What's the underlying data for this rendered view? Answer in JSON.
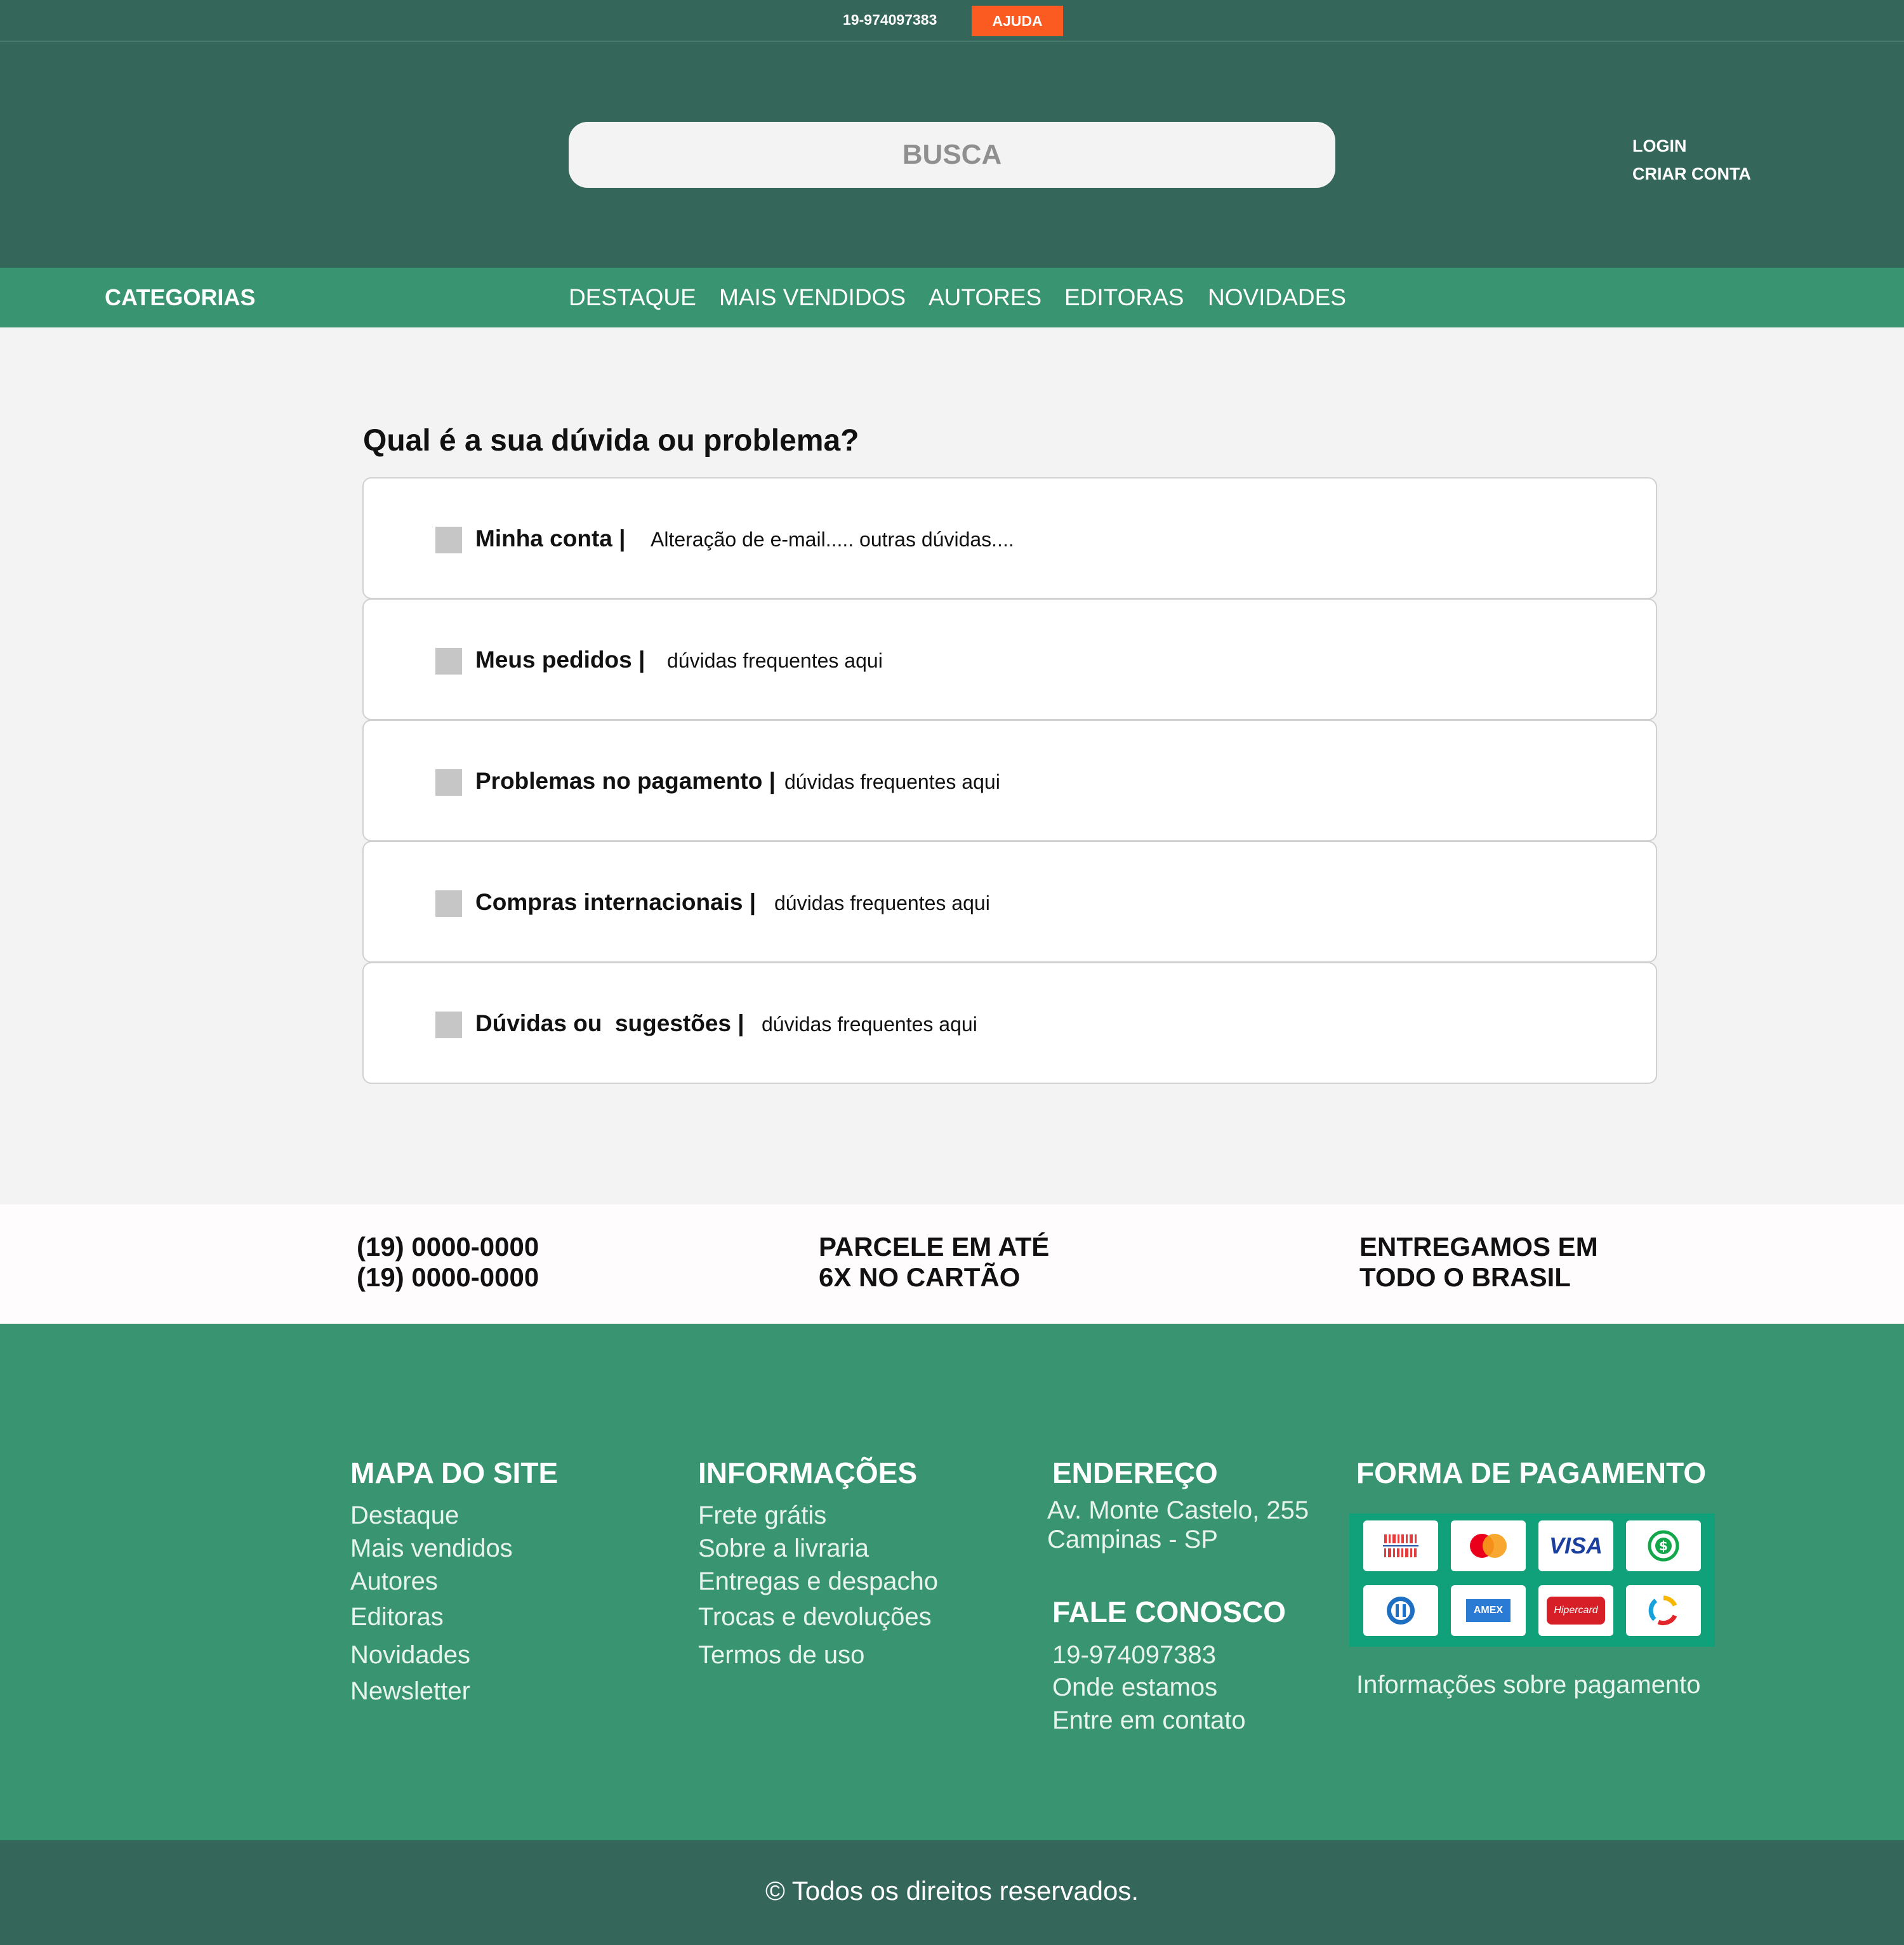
{
  "topbar": {
    "phone": "19-974097383",
    "help_label": "AJUDA"
  },
  "header": {
    "search_placeholder": "BUSCA",
    "login_label": "LOGIN",
    "signup_label": "CRIAR CONTA"
  },
  "nav": {
    "categories_label": "CATEGORIAS",
    "items": [
      "DESTAQUE",
      "MAIS VENDIDOS",
      "AUTORES",
      "EDITORAS",
      "NOVIDADES"
    ]
  },
  "faq": {
    "title": "Qual é a sua dúvida ou problema?",
    "items": [
      {
        "label": "Minha conta |",
        "desc": "Alteração de e-mail..... outras dúvidas...."
      },
      {
        "label": "Meus pedidos |",
        "desc": "dúvidas frequentes aqui"
      },
      {
        "label": "Problemas no pagamento |",
        "desc": "dúvidas frequentes aqui"
      },
      {
        "label": "Compras internacionais |",
        "desc": "dúvidas frequentes aqui"
      },
      {
        "label": "Dúvidas ou  sugestões |",
        "desc": "dúvidas frequentes aqui"
      }
    ]
  },
  "info_strip": {
    "phones": [
      "(19) 0000-0000",
      "(19) 0000-0000"
    ],
    "installments": [
      "PARCELE EM ATÉ",
      "6X NO CARTÃO"
    ],
    "delivery": [
      "ENTREGAMOS EM",
      "TODO O BRASIL"
    ]
  },
  "footer": {
    "site_map": {
      "title": "MAPA DO SITE",
      "links": [
        "Destaque",
        "Mais vendidos",
        "Autores",
        "Editoras",
        "Novidades",
        "Newsletter"
      ]
    },
    "info": {
      "title": "INFORMAÇÕES",
      "links": [
        "Frete grátis",
        "Sobre a livraria",
        "Entregas e despacho",
        "Trocas e devoluções",
        "Termos de uso"
      ]
    },
    "address": {
      "title": "ENDEREÇO",
      "lines": [
        "Av. Monte Castelo, 255",
        "Campinas - SP"
      ]
    },
    "contact": {
      "title": "FALE CONOSCO",
      "links": [
        "19-974097383",
        "Onde estamos",
        "Entre em contato"
      ]
    },
    "payment": {
      "title": "FORMA DE PAGAMENTO",
      "methods": [
        "boleto-icon",
        "mastercard-icon",
        "visa-icon",
        "cash-icon",
        "diners-icon",
        "amex-icon",
        "hipercard-icon",
        "elo-icon"
      ],
      "visa_text": "VISA",
      "amex_text": "AMEX",
      "hipercard_text": "Hipercard",
      "info_link": "Informações sobre pagamento"
    }
  },
  "copyright": "© Todos os direitos reservados.",
  "colors": {
    "dark_green": "#346659",
    "green": "#399571",
    "accent": "#fb5a21",
    "pay_panel": "#10a07a"
  }
}
